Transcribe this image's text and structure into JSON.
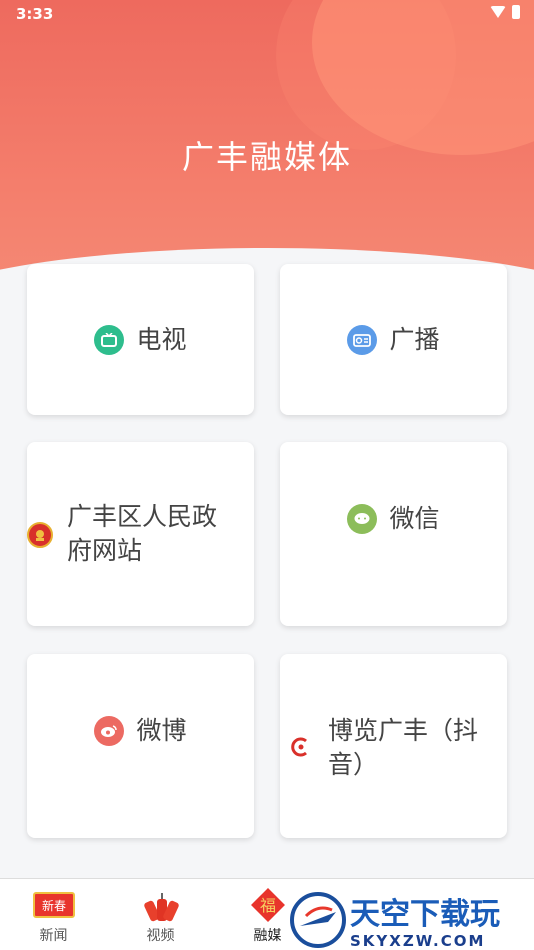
{
  "status": {
    "time": "3:33"
  },
  "header": {
    "title": "广丰融媒体"
  },
  "cards": [
    {
      "label": "电视",
      "icon": "tv-icon",
      "color": "#2ebd8d"
    },
    {
      "label": "广播",
      "icon": "radio-icon",
      "color": "#5b9be8"
    },
    {
      "label": "广丰区人民政府网站",
      "icon": "emblem-icon",
      "color": "#d8302a"
    },
    {
      "label": "微信",
      "icon": "wechat-icon",
      "color": "#8cbd5a"
    },
    {
      "label": "微博",
      "icon": "weibo-icon",
      "color": "#ec6a62"
    },
    {
      "label": "博览广丰（抖音）",
      "icon": "douyin-logo-icon",
      "color": "#d9302a"
    }
  ],
  "tabs": [
    {
      "label": "新闻",
      "icon_text": "新春"
    },
    {
      "label": "视频"
    },
    {
      "label": "融媒",
      "icon_text": "福"
    }
  ],
  "watermark": {
    "text": "天空下载玩",
    "url": "SKYXZW.COM"
  }
}
